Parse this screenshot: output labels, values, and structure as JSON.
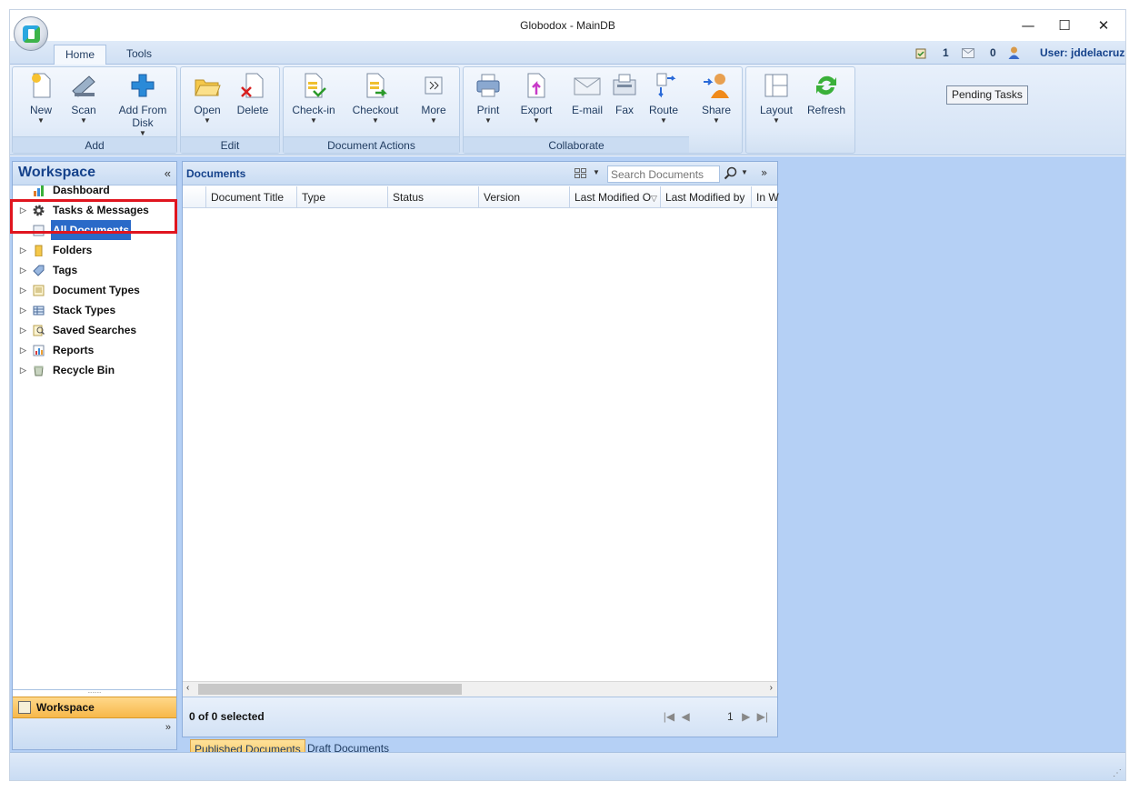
{
  "window": {
    "title": "Globodox - MainDB",
    "minimize": "—",
    "maximize": "☐",
    "close": "✕"
  },
  "tabs": [
    {
      "label": "Home",
      "active": true
    },
    {
      "label": "Tools",
      "active": false
    }
  ],
  "status": {
    "tasks_count": "1",
    "messages_count": "0",
    "user_label": "User: jddelacruz"
  },
  "ribbon": {
    "groups": {
      "add": {
        "label": "Add",
        "buttons": {
          "new": "New",
          "scan": "Scan",
          "add_from_disk": "Add From Disk"
        }
      },
      "edit": {
        "label": "Edit",
        "buttons": {
          "open": "Open",
          "delete": "Delete"
        }
      },
      "document_actions": {
        "label": "Document Actions",
        "buttons": {
          "checkin": "Check-in",
          "checkout": "Checkout",
          "more": "More"
        }
      },
      "collaborate": {
        "label": "Collaborate",
        "buttons": {
          "print": "Print",
          "export": "Export",
          "email": "E-mail",
          "fax": "Fax",
          "route": "Route"
        }
      },
      "share": {
        "label": "",
        "buttons": {
          "share": "Share"
        }
      },
      "view": {
        "label": "",
        "buttons": {
          "layout": "Layout",
          "refresh": "Refresh"
        }
      }
    },
    "pending_tasks": "Pending Tasks"
  },
  "workspace": {
    "title": "Workspace",
    "collapse": "«",
    "items": [
      {
        "label": "Dashboard",
        "expandable": false,
        "selected": false
      },
      {
        "label": "Tasks & Messages",
        "expandable": true,
        "selected": false
      },
      {
        "label": "All Documents",
        "expandable": false,
        "selected": true
      },
      {
        "label": "Folders",
        "expandable": true,
        "selected": false
      },
      {
        "label": "Tags",
        "expandable": true,
        "selected": false
      },
      {
        "label": "Document Types",
        "expandable": true,
        "selected": false
      },
      {
        "label": "Stack Types",
        "expandable": true,
        "selected": false
      },
      {
        "label": "Saved Searches",
        "expandable": true,
        "selected": false
      },
      {
        "label": "Reports",
        "expandable": true,
        "selected": false
      },
      {
        "label": "Recycle Bin",
        "expandable": true,
        "selected": false
      }
    ],
    "nav_label": "Workspace",
    "footer_chevron": "»"
  },
  "documents": {
    "title": "Documents",
    "search_placeholder": "Search Documents",
    "columns": [
      "Document Title",
      "Type",
      "Status",
      "Version",
      "Last Modified O",
      "Last Modified by",
      "In W"
    ],
    "selection": "0 of 0 selected",
    "page_number": "1",
    "tabs": [
      "Published Documents",
      "Draft Documents"
    ]
  }
}
